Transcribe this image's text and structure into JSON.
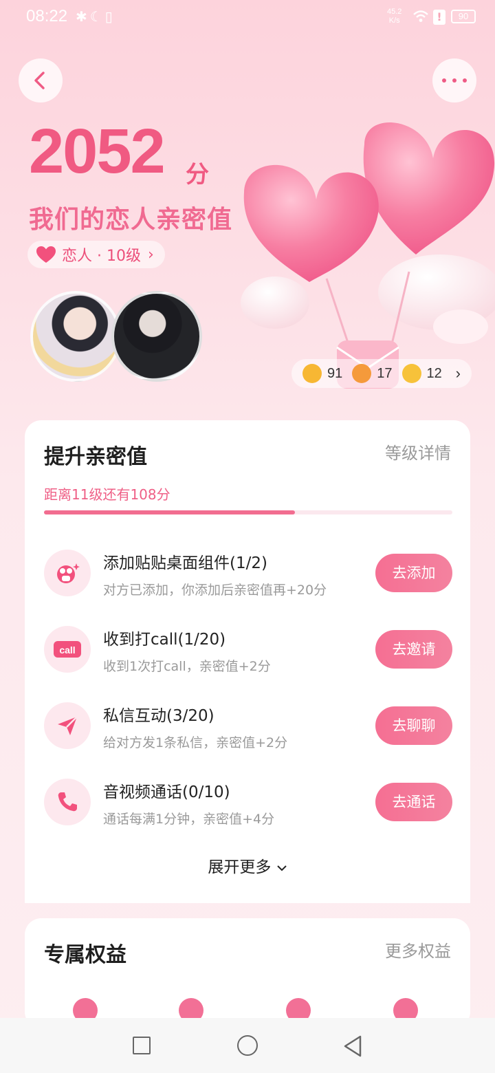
{
  "status_bar": {
    "time": "08:22",
    "icons_left": "✱☾▯",
    "speed_value": "45.2",
    "speed_unit": "K/s",
    "alert": "!",
    "battery": "90"
  },
  "header": {
    "score": "2052",
    "score_unit": "分",
    "title": "我们的恋人亲密值",
    "level_label": "恋人 · 10级"
  },
  "reactions": [
    {
      "icon": "blush-emoji-icon",
      "count": "91",
      "color": "#f7b733"
    },
    {
      "icon": "party-popper-icon",
      "count": "17",
      "color": "#f59a3b"
    },
    {
      "icon": "sleepy-emoji-icon",
      "count": "12",
      "color": "#f7c23a"
    }
  ],
  "upgrade_card": {
    "title": "提升亲密值",
    "detail_link": "等级详情",
    "progress_text": "距离11级还有108分",
    "progress": 0.615,
    "tasks": [
      {
        "icon": "sticker-widget-icon",
        "title": "添加贴贴桌面组件(1/2)",
        "sub": "对方已添加，你添加后亲密值再+20分",
        "button": "去添加"
      },
      {
        "icon": "call-badge-icon",
        "title": "收到打call(1/20)",
        "sub": "收到1次打call，亲密值+2分",
        "button": "去邀请"
      },
      {
        "icon": "send-message-icon",
        "title": "私信互动(3/20)",
        "sub": "给对方发1条私信，亲密值+2分",
        "button": "去聊聊"
      },
      {
        "icon": "phone-icon",
        "title": "音视频通话(0/10)",
        "sub": "通话每满1分钟，亲密值+4分",
        "button": "去通话"
      }
    ],
    "expand_label": "展开更多"
  },
  "rights_card": {
    "title": "专属权益",
    "more_link": "更多权益"
  },
  "colors": {
    "accent": "#f05a82",
    "button": "#f56f93"
  }
}
